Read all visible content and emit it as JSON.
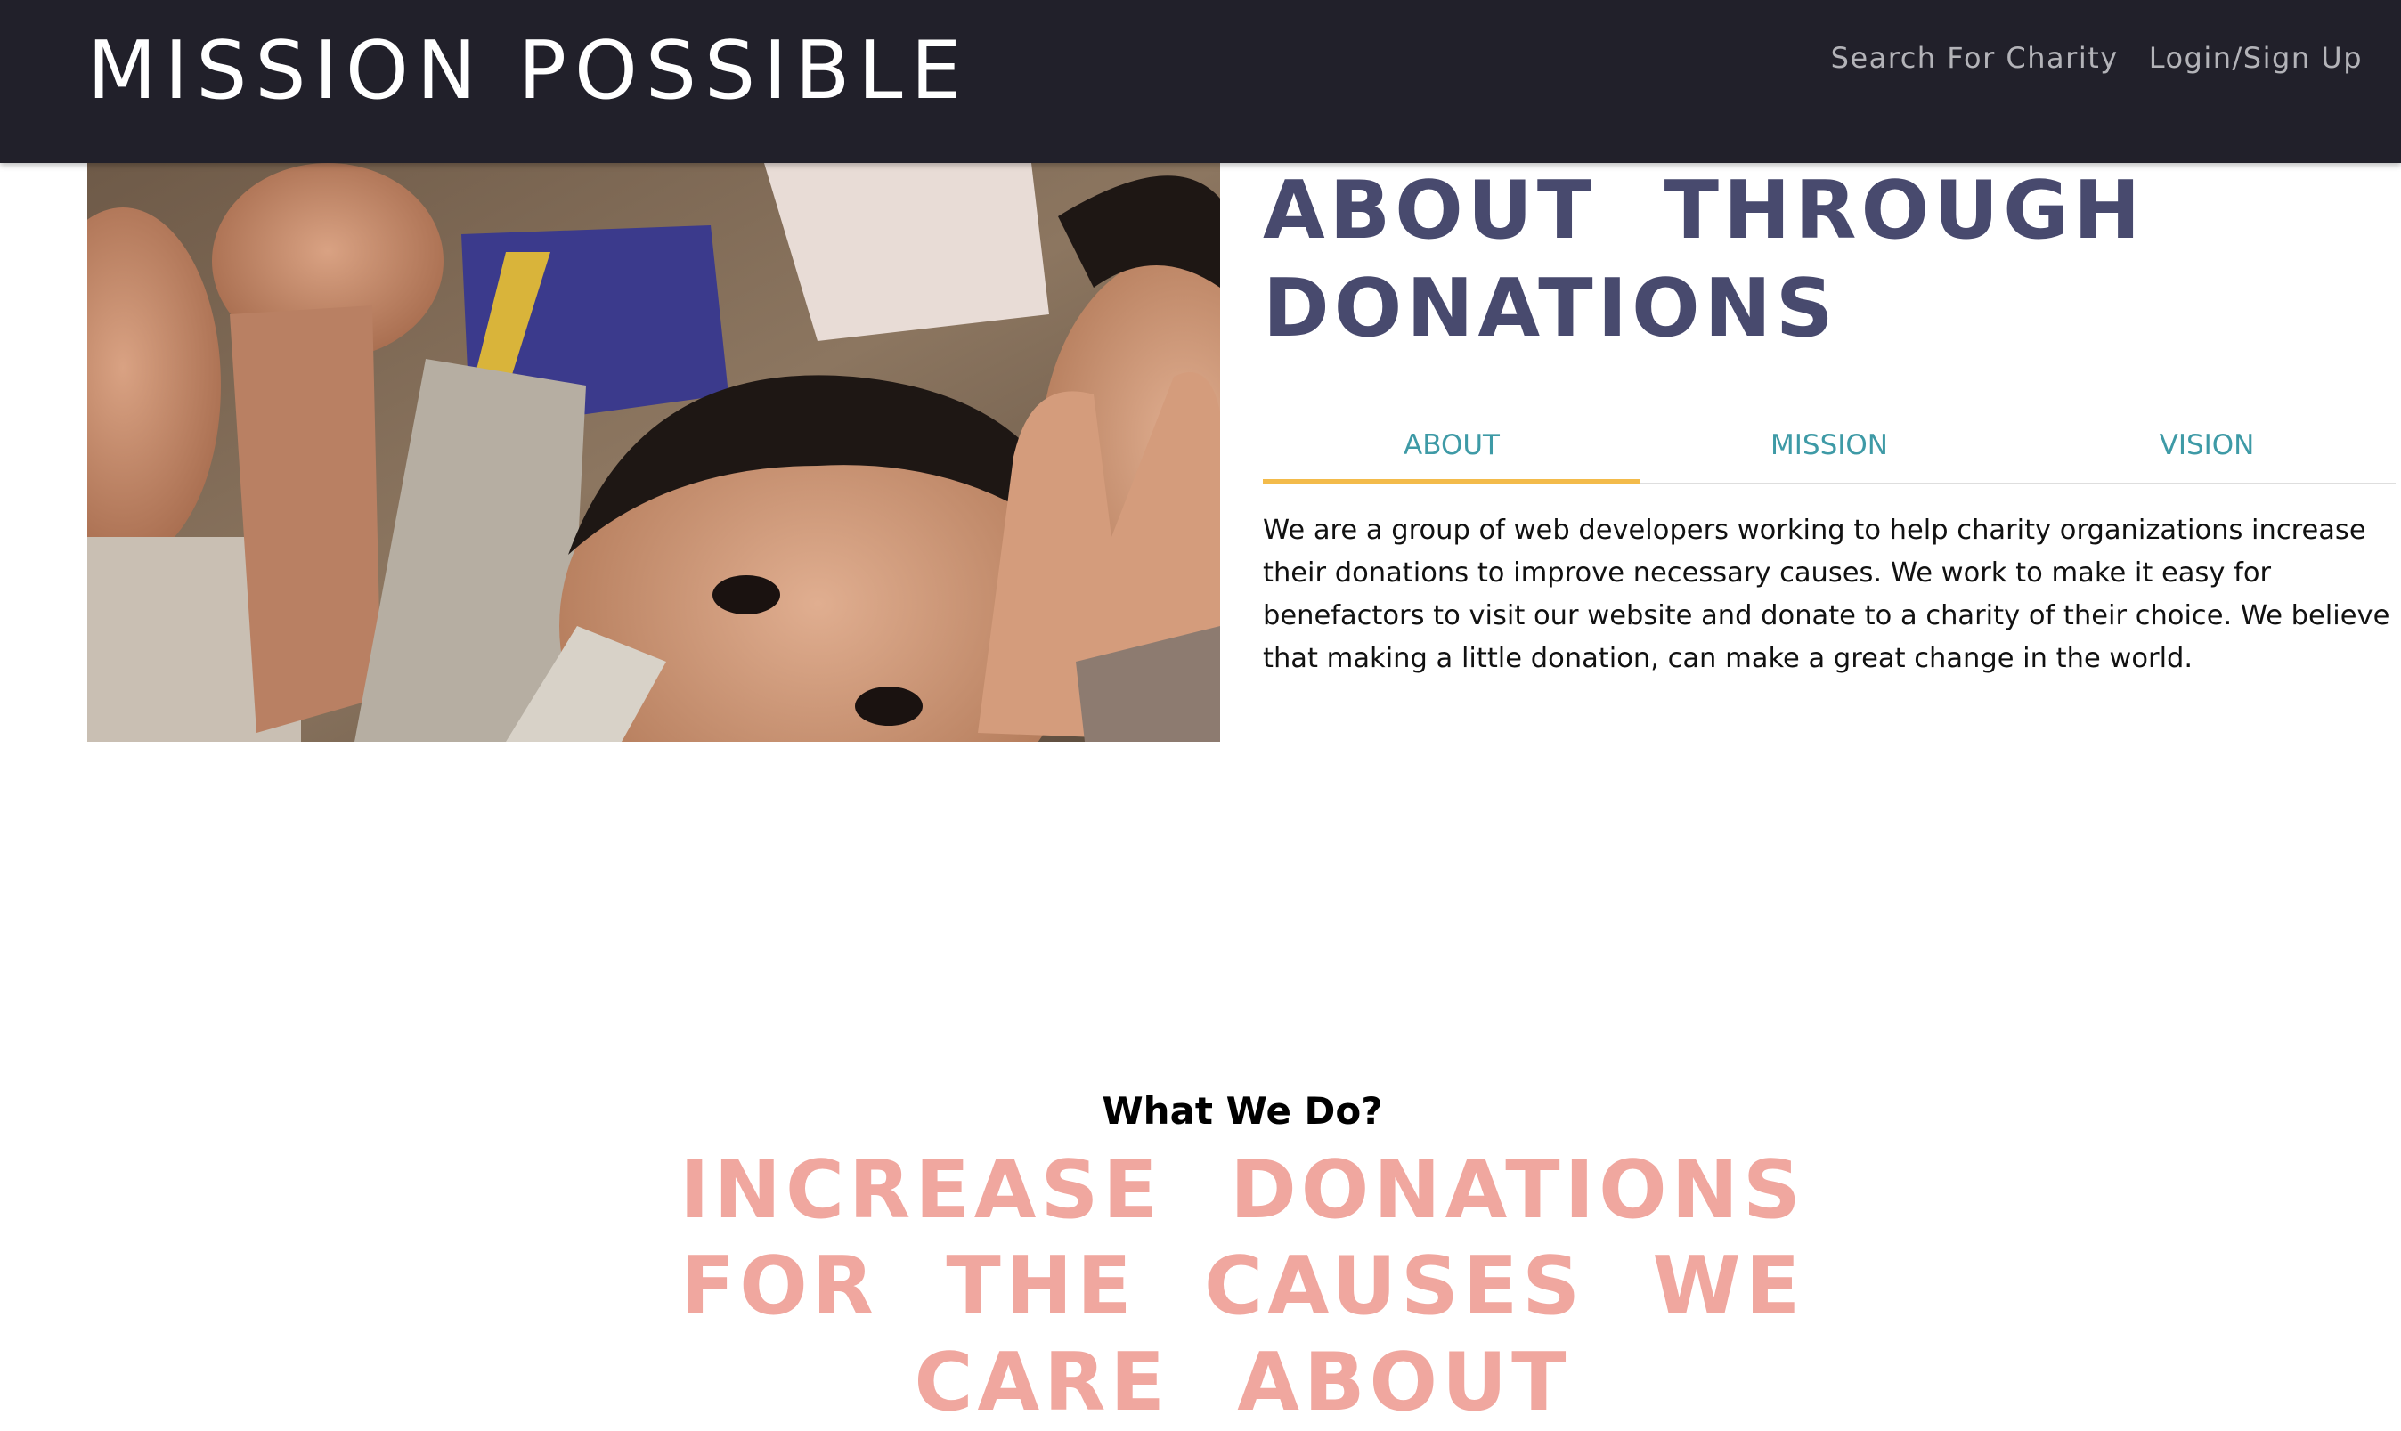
{
  "navbar": {
    "brand": "MISSION POSSIBLE",
    "links": [
      {
        "label": "Search For Charity"
      },
      {
        "label": "Login/Sign Up"
      }
    ]
  },
  "hero": {
    "image": "children-smiling-photo"
  },
  "about": {
    "heading": "ABOUT THROUGH DONATIONS",
    "tabs": [
      {
        "label": "ABOUT",
        "active": true
      },
      {
        "label": "MISSION",
        "active": false
      },
      {
        "label": "VISION",
        "active": false
      }
    ],
    "text": "We are a group of web developers working to help charity organizations increase their donations to improve necessary causes. We work to make it easy for benefactors to visit our website and donate to a charity of their choice. We believe that making a little donation, can make a great change in the world."
  },
  "what_we_do": {
    "subtitle": "What We Do?",
    "headline": "INCREASE DONATIONS FOR THE CAUSES WE CARE ABOUT"
  },
  "colors": {
    "navbar_bg": "#21202a",
    "heading": "#484a6e",
    "tab_text": "#3e9aa6",
    "tab_active_underline": "#f3bb4b",
    "headline_pink": "#f0a79f"
  }
}
